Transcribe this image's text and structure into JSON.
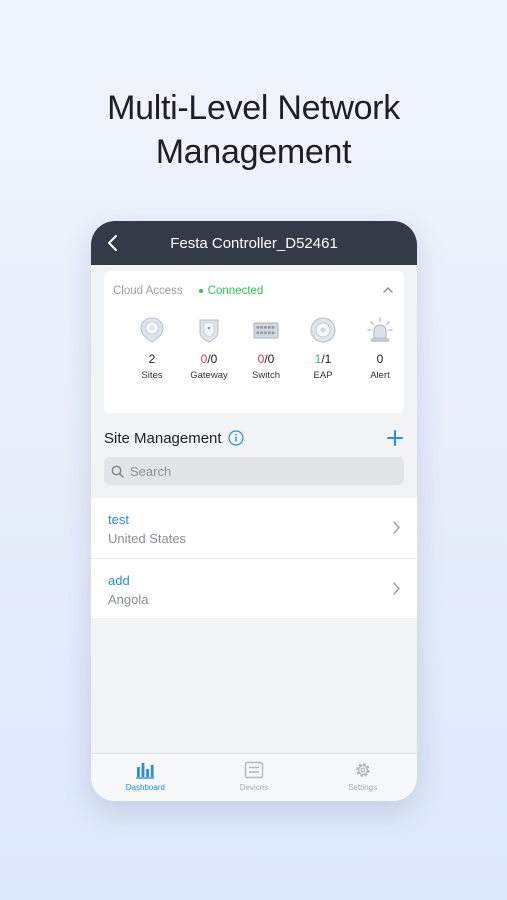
{
  "hero": {
    "line1": "Multi-Level Network",
    "line2": "Management"
  },
  "header": {
    "title": "Festa Controller_D52461"
  },
  "cloud": {
    "label": "Cloud Access",
    "status": "Connected"
  },
  "stats": {
    "sites": {
      "value": "2",
      "label": "Sites"
    },
    "gateway": {
      "online": "0",
      "total": "/0",
      "label": "Gateway"
    },
    "switch": {
      "online": "0",
      "total": "/0",
      "label": "Switch"
    },
    "eap": {
      "online": "1",
      "total": "/1",
      "label": "EAP"
    },
    "alert": {
      "value": "0",
      "label": "Alert"
    }
  },
  "site_management": {
    "title": "Site Management"
  },
  "search": {
    "placeholder": "Search"
  },
  "sites": [
    {
      "name": "test",
      "country": "United States"
    },
    {
      "name": "add",
      "country": "Angola"
    }
  ],
  "tabs": [
    {
      "label": "Dashboard"
    },
    {
      "label": "Devices"
    },
    {
      "label": "Settings"
    }
  ],
  "colors": {
    "accent": "#2a8be0",
    "connected": "#2ec24b",
    "alert_red": "#e0325b",
    "header_bg": "#343a48"
  }
}
